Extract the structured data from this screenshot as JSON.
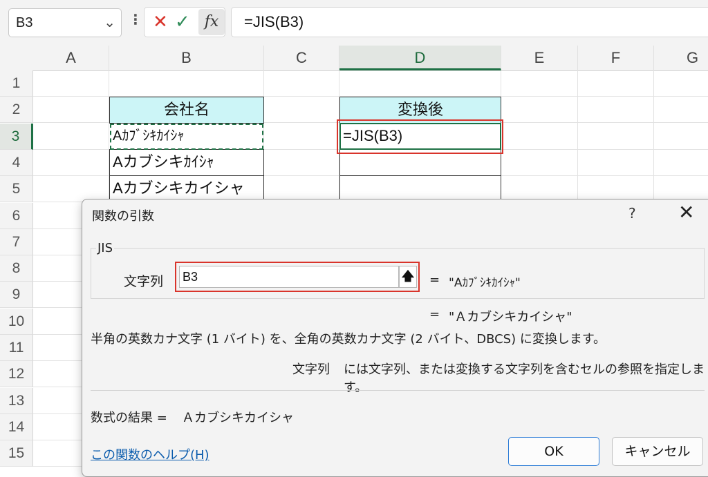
{
  "formula_bar": {
    "name_box": "B3",
    "more_glyph": "⋮",
    "cancel_glyph": "✕",
    "enter_glyph": "✓",
    "fx_label": "fx",
    "formula": "=JIS(B3)"
  },
  "columns": [
    "A",
    "B",
    "C",
    "D",
    "E",
    "F",
    "G"
  ],
  "rows": [
    "1",
    "2",
    "3",
    "4",
    "5",
    "6",
    "7",
    "8",
    "9",
    "10",
    "11",
    "12",
    "13",
    "14",
    "15"
  ],
  "active_column": "D",
  "active_row": "3",
  "cells": {
    "b2": "会社名",
    "b3": "Aｶﾌﾞｼｷｶｲｼｬ",
    "b4": "Aカブシキｶｲｼｬ",
    "b5": "Aカブシキカイシャ",
    "d2": "変換後",
    "d3": "=JIS(B3)"
  },
  "colors": {
    "header_fill": "#ccf5f7",
    "selection_green": "#1e7145",
    "highlight_red": "#d9342b"
  },
  "dialog": {
    "title": "関数の引数",
    "help_glyph": "?",
    "close_glyph": "✕",
    "function_name": "JIS",
    "argument": {
      "label": "文字列",
      "value": "B3",
      "ref_glyph": "🡅",
      "equals": "=",
      "result": "\"Aｶﾌﾞｼｷｶｲｼｬ\""
    },
    "result_equals": "=",
    "result_preview": "\"Ａカブシキカイシャ\"",
    "description": "半角の英数カナ文字 (1 バイト) を、全角の英数カナ文字 (2 バイト、DBCS) に変換します。",
    "arg_desc_name": "文字列",
    "arg_desc_text": "には文字列、または変換する文字列を含むセルの参照を指定します。",
    "formula_result_label": "数式の結果 =",
    "formula_result_value": "Ａカブシキカイシャ",
    "help_link": "この関数のヘルプ(H)",
    "ok_label": "OK",
    "cancel_label": "キャンセル"
  }
}
